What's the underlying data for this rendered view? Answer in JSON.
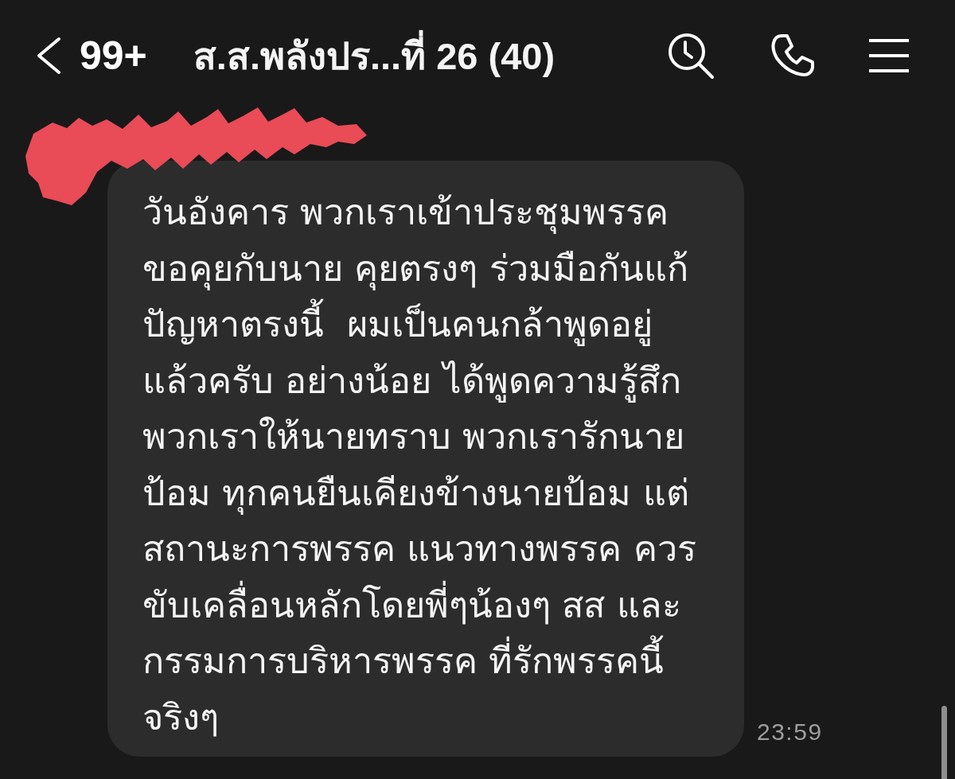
{
  "header": {
    "unread_count": "99+",
    "title": "ส.ส.พลังปร...ที่ 26 (40)"
  },
  "messages": [
    {
      "kind": "incoming",
      "redacted": true,
      "text": "วันอังคาร พวกเราเข้าประชุมพรรค\nขอคุยกับนาย คุยตรงๆ ร่วมมือกันแก้\nปัญหาตรงนี้  ผมเป็นคนกล้าพูดอยู่\nแล้วครับ อย่างน้อย ได้พูดความรู้สึก\nพวกเราให้นายทราบ พวกเรารักนาย\nป้อม ทุกคนยืนเคียงข้างนายป้อม แต่\nสถานะการพรรค แนวทางพรรค ควร\nขับเคลื่อนหลักโดยพี่ๆน้องๆ สส และ\nกรรมการบริหารพรรค ที่รักพรรคนี้\nจริงๆ",
      "time": "23:59"
    }
  ]
}
